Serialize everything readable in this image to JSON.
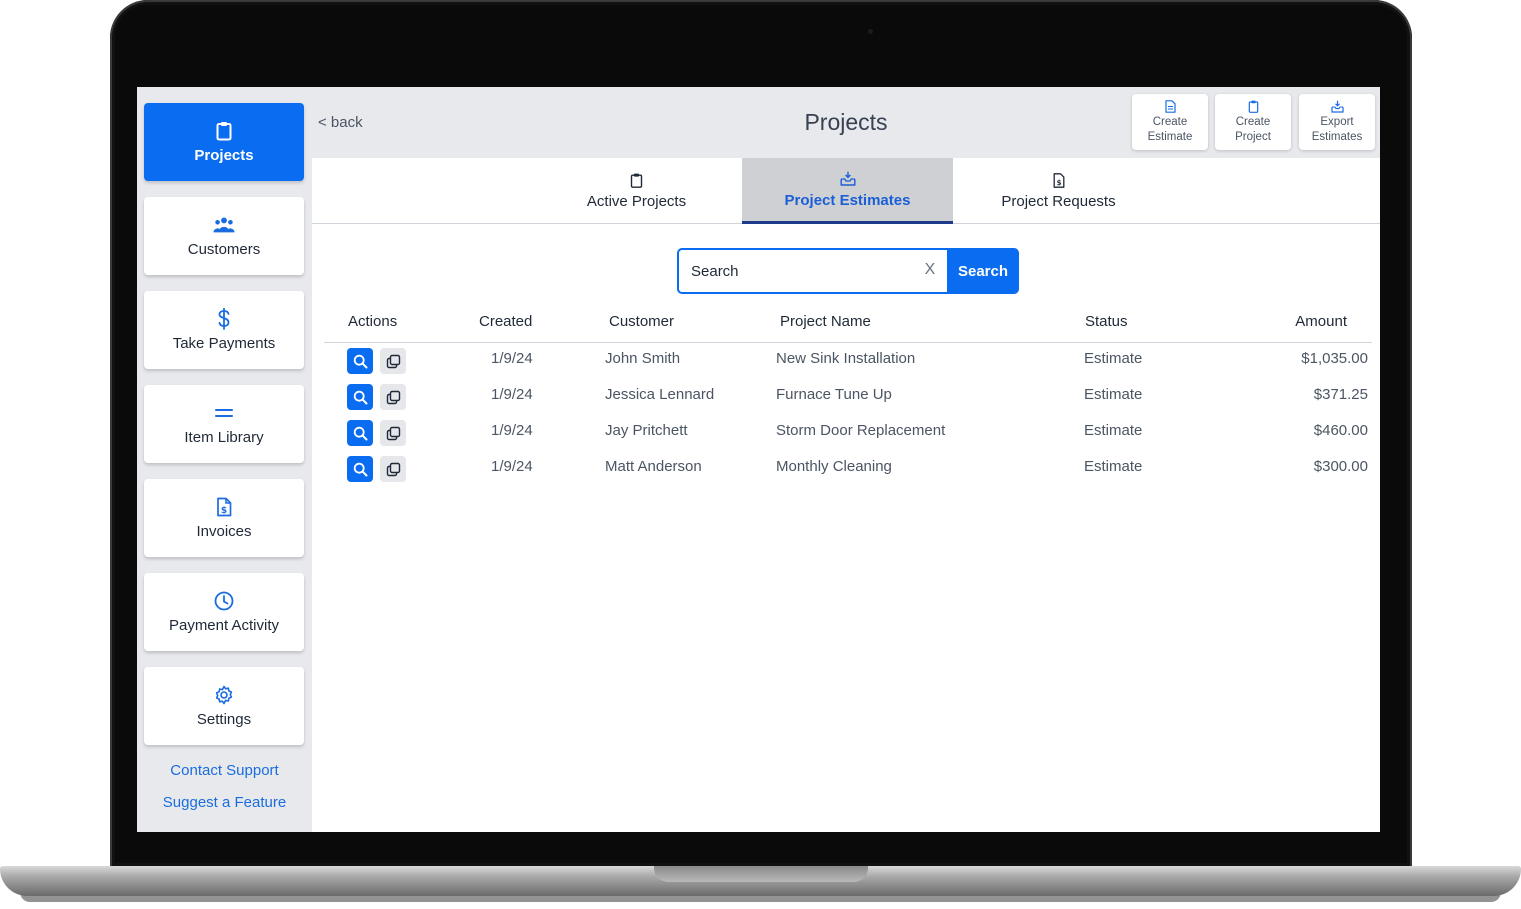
{
  "header": {
    "back_label": "< back",
    "title": "Projects",
    "actions": [
      {
        "label": "Create\nEstimate",
        "icon": "file-icon"
      },
      {
        "label": "Create\nProject",
        "icon": "clipboard-icon"
      },
      {
        "label": "Export\nEstimates",
        "icon": "inbox-export-icon"
      }
    ]
  },
  "sidebar": {
    "items": [
      {
        "label": "Projects",
        "icon": "clipboard-icon",
        "active": true
      },
      {
        "label": "Customers",
        "icon": "users-icon",
        "active": false
      },
      {
        "label": "Take Payments",
        "icon": "dollar-icon",
        "active": false
      },
      {
        "label": "Item Library",
        "icon": "equals-icon",
        "active": false
      },
      {
        "label": "Invoices",
        "icon": "invoice-icon",
        "active": false
      },
      {
        "label": "Payment Activity",
        "icon": "clock-icon",
        "active": false
      },
      {
        "label": "Settings",
        "icon": "gear-icon",
        "active": false
      }
    ],
    "links": [
      "Contact Support",
      "Suggest a Feature"
    ]
  },
  "tabs": [
    {
      "label": "Active Projects",
      "icon": "clipboard-icon",
      "active": false
    },
    {
      "label": "Project Estimates",
      "icon": "inbox-icon",
      "active": true
    },
    {
      "label": "Project Requests",
      "icon": "invoice-icon",
      "active": false
    }
  ],
  "search": {
    "placeholder": "Search",
    "clear_label": "X",
    "button_label": "Search"
  },
  "table": {
    "columns": [
      "Actions",
      "Created",
      "Customer",
      "Project Name",
      "Status",
      "Amount"
    ],
    "rows": [
      {
        "created": "1/9/24",
        "customer": "John Smith",
        "project": "New Sink Installation",
        "status": "Estimate",
        "amount": "$1,035.00"
      },
      {
        "created": "1/9/24",
        "customer": "Jessica Lennard",
        "project": "Furnace Tune Up",
        "status": "Estimate",
        "amount": "$371.25"
      },
      {
        "created": "1/9/24",
        "customer": "Jay Pritchett",
        "project": "Storm Door Replacement",
        "status": "Estimate",
        "amount": "$460.00"
      },
      {
        "created": "1/9/24",
        "customer": "Matt Anderson",
        "project": "Monthly Cleaning",
        "status": "Estimate",
        "amount": "$300.00"
      }
    ]
  },
  "colors": {
    "accent": "#0a6cf0",
    "sidebar_bg": "#e8e9ec",
    "link": "#1a6de0"
  }
}
